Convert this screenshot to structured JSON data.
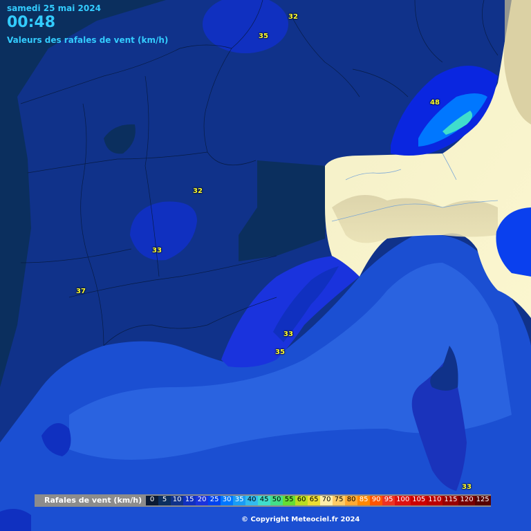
{
  "header": {
    "date": "samedi 25 mai 2024",
    "time": "00:48",
    "title": "Valeurs des rafales de vent (km/h)"
  },
  "labels": [
    "32",
    "35",
    "48",
    "32",
    "33",
    "37",
    "33",
    "35",
    "33"
  ],
  "legend": {
    "label": "Rafales de vent (km/h)",
    "items": [
      {
        "v": "0",
        "c": "#0a1a33"
      },
      {
        "v": "5",
        "c": "#0b2f5e"
      },
      {
        "v": "10",
        "c": "#10328a"
      },
      {
        "v": "15",
        "c": "#1030c0"
      },
      {
        "v": "20",
        "c": "#1a33dd"
      },
      {
        "v": "25",
        "c": "#0044ee"
      },
      {
        "v": "30",
        "c": "#0077ff"
      },
      {
        "v": "35",
        "c": "#1a9cf5"
      },
      {
        "v": "40",
        "c": "#33bbee"
      },
      {
        "v": "45",
        "c": "#40ddcc"
      },
      {
        "v": "50",
        "c": "#44dd88"
      },
      {
        "v": "55",
        "c": "#66dd33"
      },
      {
        "v": "60",
        "c": "#bbdd22"
      },
      {
        "v": "65",
        "c": "#eedd33"
      },
      {
        "v": "70",
        "c": "#ffeeaa"
      },
      {
        "v": "75",
        "c": "#ffcc66"
      },
      {
        "v": "80",
        "c": "#ffaa33"
      },
      {
        "v": "85",
        "c": "#ff8800"
      },
      {
        "v": "90",
        "c": "#ff5500"
      },
      {
        "v": "95",
        "c": "#ee3322"
      },
      {
        "v": "100",
        "c": "#dd1111"
      },
      {
        "v": "105",
        "c": "#cc0000"
      },
      {
        "v": "110",
        "c": "#bb0000"
      },
      {
        "v": "115",
        "c": "#990000"
      },
      {
        "v": "120",
        "c": "#770000"
      },
      {
        "v": "125",
        "c": "#550000"
      }
    ]
  },
  "copyright": "© Copyright Meteociel.fr 2024"
}
